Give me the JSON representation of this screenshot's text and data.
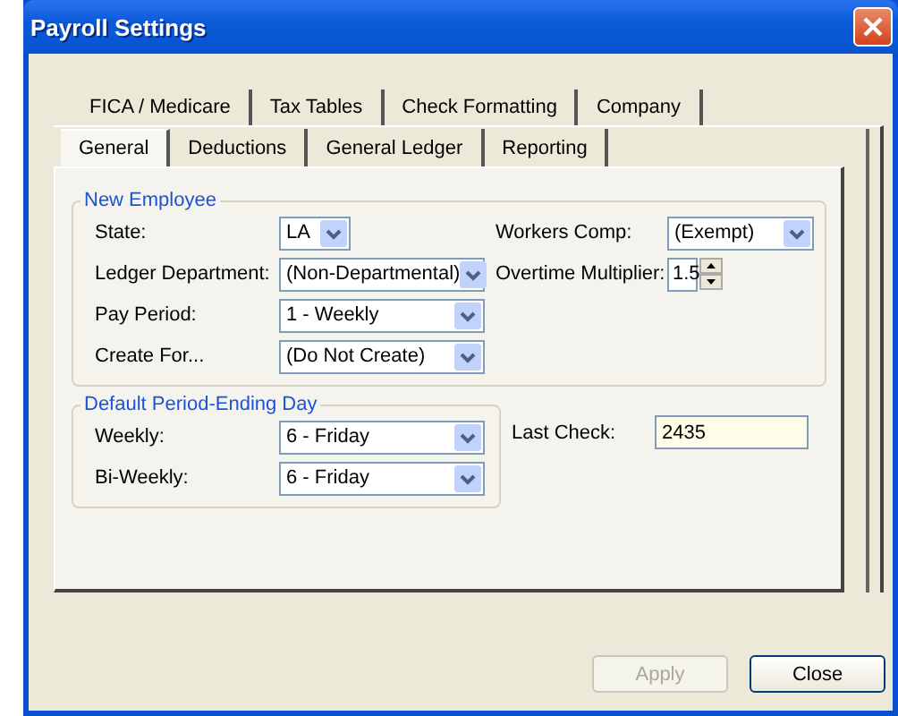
{
  "window": {
    "title": "Payroll Settings"
  },
  "tab_rows": [
    {
      "tabs": [
        {
          "label": "FICA / Medicare",
          "selected": false
        },
        {
          "label": "Tax Tables",
          "selected": false
        },
        {
          "label": "Check Formatting",
          "selected": false
        },
        {
          "label": "Company",
          "selected": false
        }
      ]
    },
    {
      "tabs": [
        {
          "label": "General",
          "selected": true
        },
        {
          "label": "Deductions",
          "selected": false
        },
        {
          "label": "General Ledger",
          "selected": false
        },
        {
          "label": "Reporting",
          "selected": false
        }
      ]
    }
  ],
  "new_employee": {
    "title": "New Employee",
    "left_fields": [
      {
        "label": "State:",
        "kind": "combo",
        "value": "LA"
      },
      {
        "label": "Ledger Department:",
        "kind": "combo",
        "value": "(Non-Departmental)"
      },
      {
        "label": "Pay Period:",
        "kind": "combo",
        "value": "1 - Weekly"
      },
      {
        "label": "Create For...",
        "kind": "combo",
        "value": "(Do Not Create)"
      }
    ],
    "right_fields": [
      {
        "label": "Workers Comp:",
        "kind": "combo",
        "value": "(Exempt)"
      },
      {
        "label": "Overtime Multiplier:",
        "kind": "spinner",
        "value": "1.5"
      }
    ]
  },
  "period_ending": {
    "title": "Default Period-Ending Day",
    "fields": [
      {
        "label": "Weekly:",
        "kind": "combo",
        "value": "6 - Friday"
      },
      {
        "label": "Bi-Weekly:",
        "kind": "combo",
        "value": "6 - Friday"
      }
    ]
  },
  "last_check": {
    "label": "Last Check:",
    "kind": "text",
    "value": "2435"
  },
  "buttons": [
    {
      "label": "Apply",
      "disabled": true
    },
    {
      "label": "Close",
      "disabled": false
    }
  ]
}
